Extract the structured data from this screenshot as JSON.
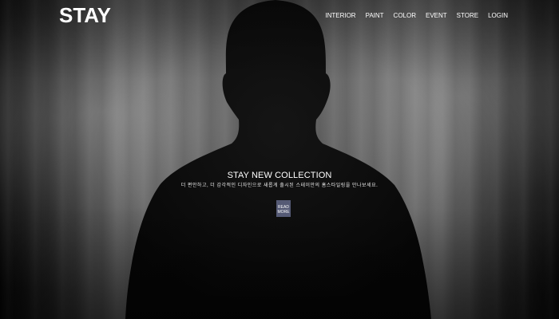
{
  "header": {
    "logo": "STAY",
    "nav": [
      {
        "label": "INTERIOR"
      },
      {
        "label": "PAINT"
      },
      {
        "label": "COLOR"
      },
      {
        "label": "EVENT"
      },
      {
        "label": "STORE"
      },
      {
        "label": "LOGIN"
      }
    ]
  },
  "hero": {
    "title": "STAY NEW COLLECTION",
    "subtitle": "더 편안하고, 더 감각적인 디자인으로 새롭게 출시된 스테이만의 홈스타일링을 만나보세요.",
    "button_label": "READ MORE"
  },
  "colors": {
    "button_bg": "#555a75",
    "text": "#ffffff"
  }
}
